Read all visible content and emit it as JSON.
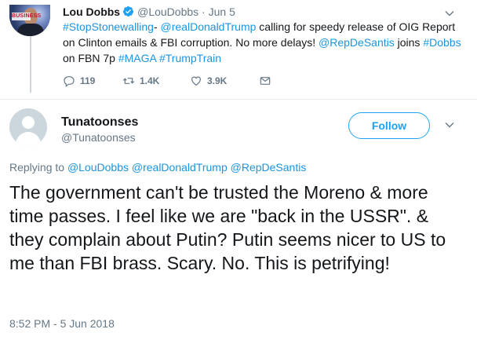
{
  "parent_tweet": {
    "name": "Lou Dobbs",
    "handle": "@LouDobbs",
    "separator": "·",
    "date": "Jun 5",
    "avatar_badge": "BUSINESS",
    "text_parts": [
      {
        "t": "#StopStonewalling",
        "link": true
      },
      {
        "t": "- ",
        "link": false
      },
      {
        "t": "@realDonaldTrump",
        "link": true
      },
      {
        "t": " calling for speedy release of OIG Report on Clinton emails & FBI corruption. No more delays! ",
        "link": false
      },
      {
        "t": "@RepDeSantis",
        "link": true
      },
      {
        "t": " joins ",
        "link": false
      },
      {
        "t": "#Dobbs",
        "link": true
      },
      {
        "t": " on FBN 7p ",
        "link": false
      },
      {
        "t": "#MAGA",
        "link": true
      },
      {
        "t": " ",
        "link": false
      },
      {
        "t": "#TrumpTrain",
        "link": true
      }
    ],
    "actions": {
      "replies": "119",
      "retweets": "1.4K",
      "likes": "3.9K"
    }
  },
  "reply_tweet": {
    "name": "Tunatoonses",
    "handle": "@Tunatoonses",
    "follow_label": "Follow",
    "replying_prefix": "Replying to",
    "replying_to": [
      "@LouDobbs",
      "@realDonaldTrump",
      "@RepDeSantis"
    ],
    "text": "The government can't be trusted the Moreno & more time passes. I feel like we are \"back in the USSR\". & they complain about Putin? Putin seems nicer to US to me than FBI brass. Scary. No. This is petrifying!",
    "timestamp": "8:52 PM - 5 Jun 2018"
  },
  "colors": {
    "link": "#1b95e0",
    "follow": "#1da1f2",
    "muted": "#657786",
    "text": "#14171a",
    "verified": "#1da1f2"
  },
  "icons": {
    "verified": "verified-badge-icon",
    "reply": "reply-icon",
    "retweet": "retweet-icon",
    "like": "heart-icon",
    "dm": "envelope-icon",
    "more": "chevron-down-icon"
  }
}
